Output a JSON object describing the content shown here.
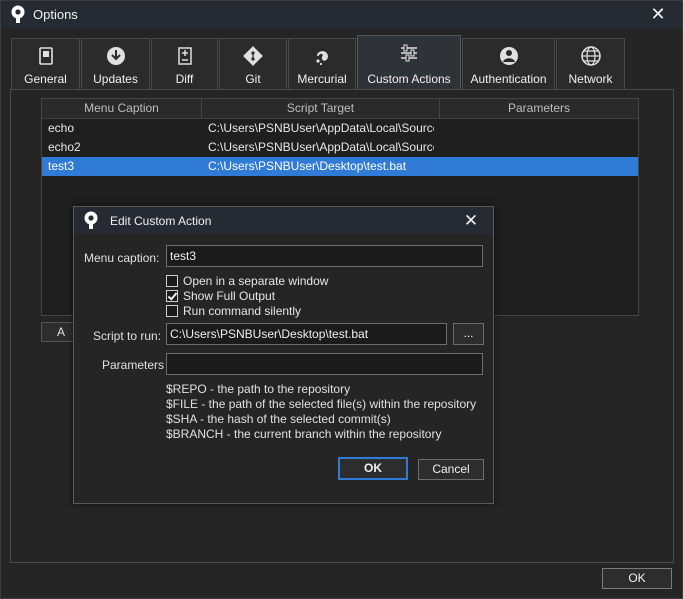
{
  "window": {
    "title": "Options"
  },
  "tabs": [
    {
      "label": "General",
      "icon": "switch-icon"
    },
    {
      "label": "Updates",
      "icon": "download-icon"
    },
    {
      "label": "Diff",
      "icon": "diff-icon"
    },
    {
      "label": "Git",
      "icon": "git-icon"
    },
    {
      "label": "Mercurial",
      "icon": "mercurial-icon"
    },
    {
      "label": "Custom Actions",
      "icon": "custom-actions-icon"
    },
    {
      "label": "Authentication",
      "icon": "user-icon"
    },
    {
      "label": "Network",
      "icon": "globe-icon"
    }
  ],
  "active_tab": "Custom Actions",
  "actions_table": {
    "columns": [
      "Menu Caption",
      "Script Target",
      "Parameters"
    ],
    "rows": [
      {
        "caption": "echo",
        "target": "C:\\Users\\PSNBUser\\AppData\\Local\\Source",
        "params": ""
      },
      {
        "caption": "echo2",
        "target": "C:\\Users\\PSNBUser\\AppData\\Local\\Source",
        "params": ""
      },
      {
        "caption": "test3",
        "target": "C:\\Users\\PSNBUser\\Desktop\\test.bat",
        "params": ""
      }
    ],
    "selected_row": "test3",
    "partial_button_label": "A"
  },
  "footer": {
    "ok_label": "OK"
  },
  "dialog": {
    "title": "Edit Custom Action",
    "menu_caption_label": "Menu caption:",
    "menu_caption_value": "test3",
    "checkboxes": [
      {
        "label": "Open in a separate window",
        "checked": false
      },
      {
        "label": "Show Full Output",
        "checked": true
      },
      {
        "label": "Run command silently",
        "checked": false
      }
    ],
    "script_label": "Script to run:",
    "script_value": "C:\\Users\\PSNBUser\\Desktop\\test.bat",
    "browse_label": "...",
    "parameters_label": "Parameters",
    "parameters_value": "",
    "help_lines": [
      "$REPO - the path to the repository",
      "$FILE - the path of the selected file(s) within the repository",
      "$SHA - the hash of the selected commit(s)",
      "$BRANCH - the current branch within the repository"
    ],
    "ok_label": "OK",
    "cancel_label": "Cancel"
  },
  "colors": {
    "accent": "#2f7bd6",
    "background": "#252526",
    "titlebar": "#262b33"
  }
}
